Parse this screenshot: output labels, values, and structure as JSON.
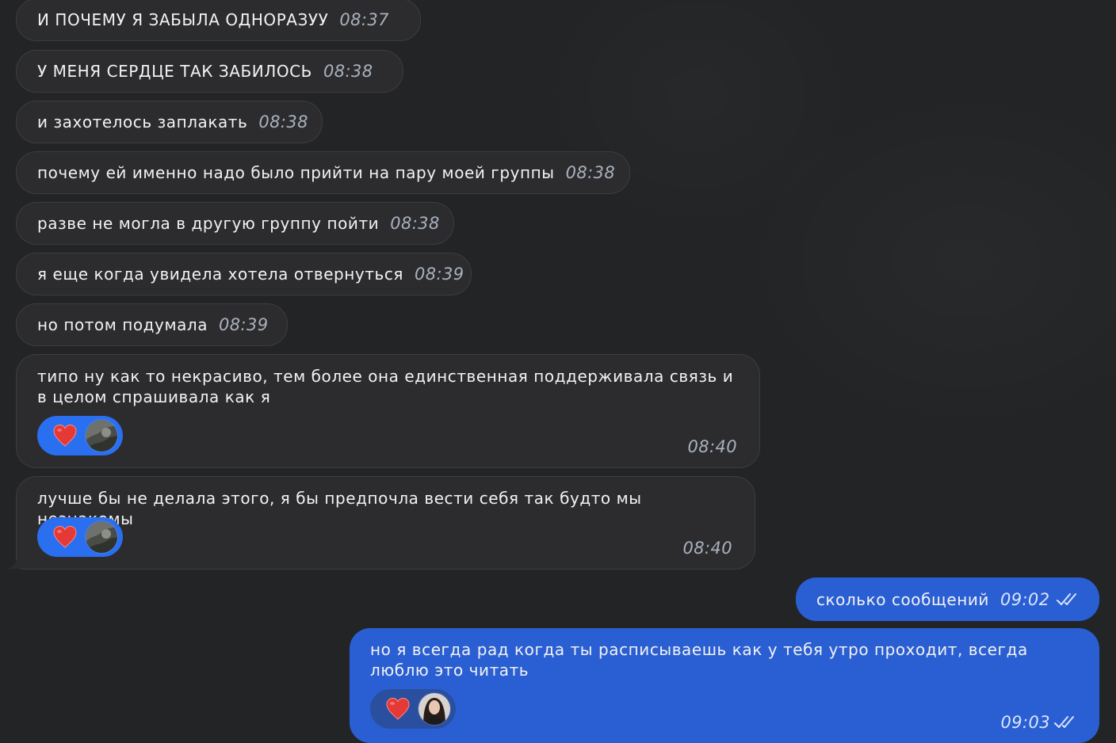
{
  "chat": {
    "messages": [
      {
        "text": "И ПОЧЕМУ Я ЗАБЫЛА ОДНОРАЗУУ",
        "time": "08:37"
      },
      {
        "text": "У МЕНЯ СЕРДЦЕ ТАК ЗАБИЛОСЬ",
        "time": "08:38"
      },
      {
        "text": "и захотелось заплакать",
        "time": "08:38"
      },
      {
        "text": "почему ей именно надо было прийти на пару моей группы",
        "time": "08:38"
      },
      {
        "text": "разве не могла в другую группу пойти",
        "time": "08:38"
      },
      {
        "text": "я еще когда увидела хотела отвернуться",
        "time": "08:39"
      },
      {
        "text": "но потом подумала",
        "time": "08:39"
      },
      {
        "text": "типо ну как то некрасиво, тем более она единственная поддерживала связь и в целом спрашивала как я",
        "time": "08:40",
        "reaction": {
          "emoji": "heart-icon",
          "by": "avatar"
        }
      },
      {
        "text": "лучше бы не делала этого, я бы предпочла вести себя так будто мы незнакомы",
        "time": "08:40",
        "reaction": {
          "emoji": "heart-icon",
          "by": "avatar"
        }
      }
    ],
    "outgoing": [
      {
        "text": "сколько сообщений",
        "time": "09:02",
        "status": "read"
      },
      {
        "text": "но я всегда рад когда ты расписываешь как у тебя утро проходит, всегда люблю это читать",
        "time": "09:03",
        "status": "read",
        "reaction": {
          "emoji": "heart-icon",
          "by": "avatar"
        }
      }
    ]
  },
  "colors": {
    "background": "#222426",
    "incoming_bubble": "#2c2c2e",
    "outgoing_bubble": "#2a5fd3",
    "reaction_pill": "#2a6ff0",
    "heart": "#e53935"
  }
}
